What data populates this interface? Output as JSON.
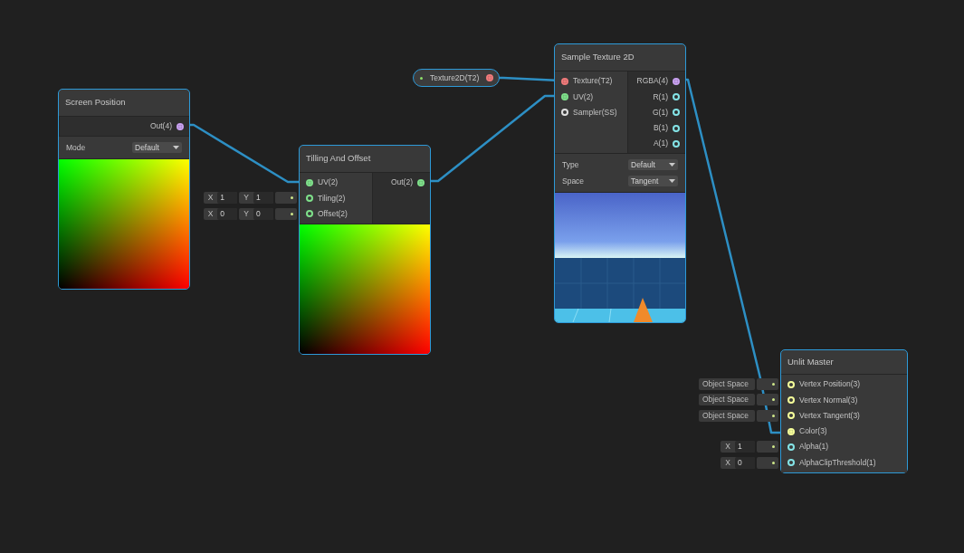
{
  "property": {
    "label": "Texture2D(T2)",
    "color": "#f07a7a",
    "connected": true
  },
  "nodes": [
    {
      "title": "Screen Position",
      "selected": true,
      "outputs": [
        {
          "label": "Out(4)",
          "color": "#c8a0f0",
          "connected": true
        }
      ],
      "settings": [
        {
          "label": "Mode",
          "value": "Default"
        }
      ],
      "preview": {
        "kind": "gradient"
      }
    },
    {
      "title": "Tilling And Offset",
      "selected": true,
      "inputs": [
        {
          "label": "UV(2)",
          "color": "#7ee08a",
          "connected": true
        },
        {
          "label": "Tiling(2)",
          "color": "#7ee08a",
          "connected": false,
          "inline": {
            "kind": "vector",
            "fields": [
              {
                "axis": "X",
                "value": "1"
              },
              {
                "axis": "Y",
                "value": "1"
              }
            ]
          }
        },
        {
          "label": "Offset(2)",
          "color": "#7ee08a",
          "connected": false,
          "inline": {
            "kind": "vector",
            "fields": [
              {
                "axis": "X",
                "value": "0"
              },
              {
                "axis": "Y",
                "value": "0"
              }
            ]
          }
        }
      ],
      "outputs": [
        {
          "label": "Out(2)",
          "color": "#7ee08a",
          "connected": true
        }
      ],
      "preview": {
        "kind": "gradient"
      }
    },
    {
      "title": "Sample Texture 2D",
      "selected": true,
      "inputs": [
        {
          "label": "Texture(T2)",
          "color": "#f07a7a",
          "connected": true
        },
        {
          "label": "UV(2)",
          "color": "#7ee08a",
          "connected": true
        },
        {
          "label": "Sampler(SS)",
          "color": "#e0e0e0",
          "connected": false
        }
      ],
      "outputs": [
        {
          "label": "RGBA(4)",
          "color": "#c8a0f0",
          "connected": true
        },
        {
          "label": "R(1)",
          "color": "#84e4e7",
          "connected": false
        },
        {
          "label": "G(1)",
          "color": "#84e4e7",
          "connected": false
        },
        {
          "label": "B(1)",
          "color": "#84e4e7",
          "connected": false
        },
        {
          "label": "A(1)",
          "color": "#84e4e7",
          "connected": false
        }
      ],
      "settings": [
        {
          "label": "Type",
          "value": "Default"
        },
        {
          "label": "Space",
          "value": "Tangent"
        }
      ],
      "preview": {
        "kind": "picture"
      }
    },
    {
      "title": "Unlit Master",
      "selected": true,
      "inputs": [
        {
          "label": "Vertex Position(3)",
          "color": "#f6ff9a",
          "connected": false,
          "inline": {
            "kind": "dropdown",
            "value": "Object Space"
          }
        },
        {
          "label": "Vertex Normal(3)",
          "color": "#f6ff9a",
          "connected": false,
          "inline": {
            "kind": "dropdown",
            "value": "Object Space"
          }
        },
        {
          "label": "Vertex Tangent(3)",
          "color": "#f6ff9a",
          "connected": false,
          "inline": {
            "kind": "dropdown",
            "value": "Object Space"
          }
        },
        {
          "label": "Color(3)",
          "color": "#f6ff9a",
          "connected": true
        },
        {
          "label": "Alpha(1)",
          "color": "#84e4e7",
          "connected": false,
          "inline": {
            "kind": "vector",
            "fields": [
              {
                "axis": "X",
                "value": "1"
              }
            ]
          }
        },
        {
          "label": "AlphaClipThreshold(1)",
          "color": "#84e4e7",
          "connected": false,
          "inline": {
            "kind": "vector",
            "fields": [
              {
                "axis": "X",
                "value": "0"
              }
            ]
          }
        }
      ],
      "preview": {
        "kind": "none"
      }
    }
  ]
}
